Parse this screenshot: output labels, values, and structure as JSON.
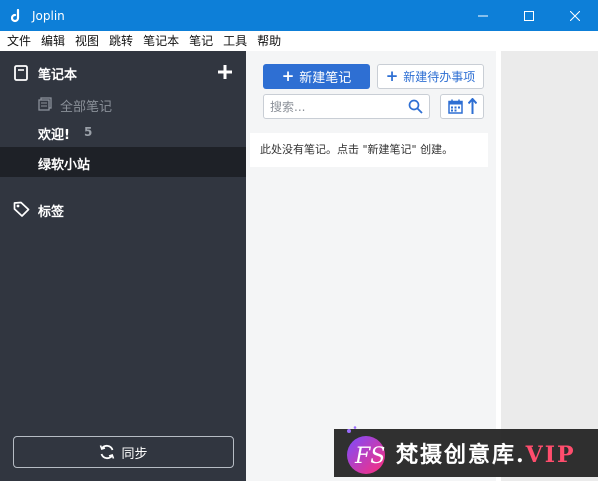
{
  "window": {
    "title": "Joplin"
  },
  "menubar": [
    "文件",
    "编辑",
    "视图",
    "跳转",
    "笔记本",
    "笔记",
    "工具",
    "帮助"
  ],
  "sidebar": {
    "header_label": "笔记本",
    "all_notes_label": "全部笔记",
    "notebooks": [
      {
        "label": "欢迎!",
        "count": "5",
        "selected": false
      },
      {
        "label": "绿软小站",
        "count": "",
        "selected": true
      }
    ],
    "tags_label": "标签",
    "sync_label": "同步"
  },
  "notelist": {
    "new_note_label": "新建笔记",
    "new_todo_label": "新建待办事项",
    "search_placeholder": "搜索...",
    "empty_message": "此处没有笔记。点击 \"新建笔记\" 创建。"
  },
  "watermark": {
    "text": "梵摄创意库.",
    "vip": "VIP",
    "logo_text": "FS"
  },
  "colors": {
    "titlebar": "#0d7fd8",
    "sidebar": "#313640",
    "accent": "#2e6fd3",
    "watermark_accent": "#ff4d6d"
  },
  "icons": [
    "joplin-logo-icon",
    "minimize-icon",
    "maximize-icon",
    "close-icon",
    "notebook-icon",
    "plus-icon",
    "all-notes-icon",
    "tag-icon",
    "sync-icon",
    "search-icon",
    "calendar-icon",
    "sort-arrow-icon"
  ]
}
